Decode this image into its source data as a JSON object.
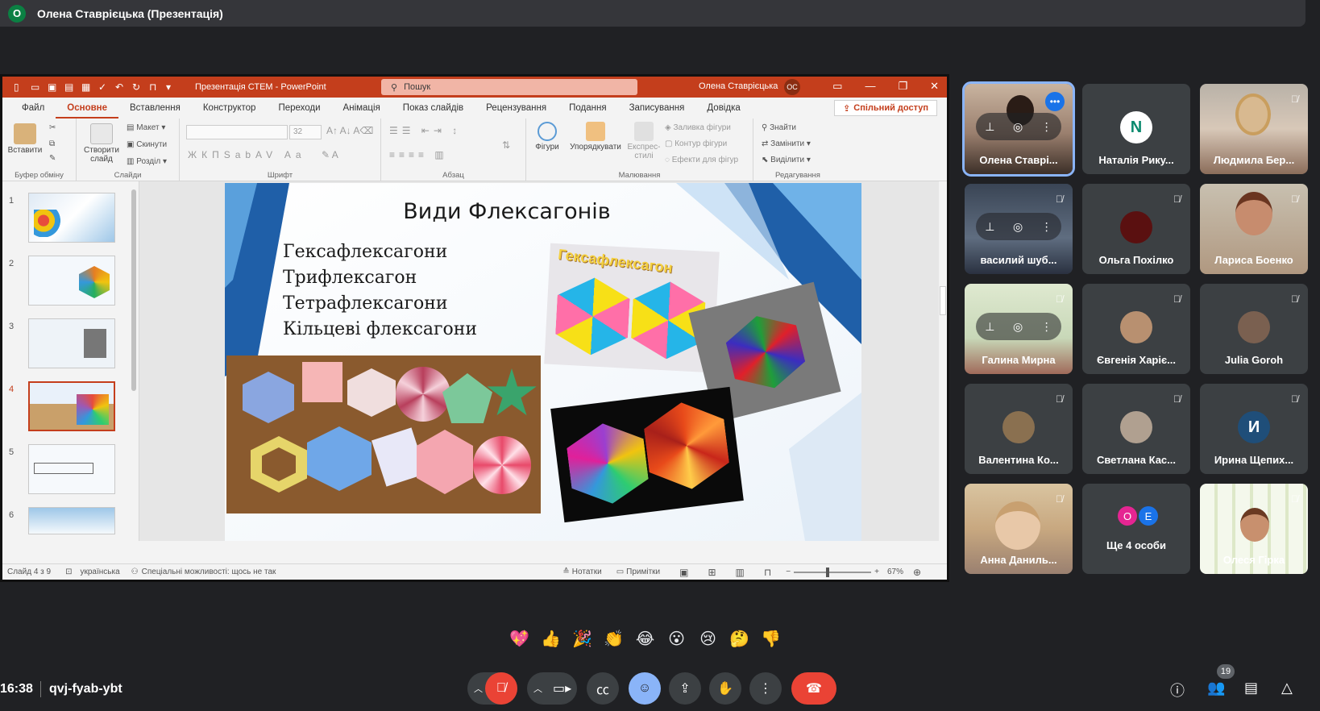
{
  "presenter": {
    "avatar": "О",
    "name": "Олена Ставрієцька (Презентація)"
  },
  "ppt": {
    "doc_title": "Презентація СТЕМ  -  PowerPoint",
    "search_placeholder": "Пошук",
    "user": "Олена Ставрієцька",
    "user_initials": "ОС",
    "tabs": [
      "Файл",
      "Основне",
      "Вставлення",
      "Конструктор",
      "Переходи",
      "Анімація",
      "Показ слайдів",
      "Рецензування",
      "Подання",
      "Записування",
      "Довідка"
    ],
    "share_label": "Спільний доступ",
    "ribbon": {
      "paste": "Вставити",
      "clipboard": "Буфер обміну",
      "new_slide": "Створити слайд",
      "layout": "Макет",
      "reset": "Скинути",
      "section": "Розділ",
      "slides": "Слайди",
      "font_group": "Шрифт",
      "font_size": "32",
      "paragraph": "Абзац",
      "shapes": "Фігури",
      "arrange": "Упорядкувати",
      "quick_styles": "Експрес-стилі",
      "shape_fill": "Заливка фігури",
      "shape_outline": "Контур фігури",
      "shape_effects": "Ефекти для фігур",
      "drawing": "Малювання",
      "find": "Знайти",
      "replace": "Замінити",
      "select": "Виділити",
      "editing": "Редагування"
    },
    "thumbnails": [
      "1",
      "2",
      "3",
      "4",
      "5",
      "6"
    ],
    "slide": {
      "title": "Види Флексагонів",
      "items": [
        "Гексафлексагони",
        "Трифлексагон",
        "Тетрафлексагони",
        "Кільцеві флексагони"
      ],
      "photo_caption": "Гексафлексагон"
    },
    "status": {
      "slide_of": "Слайд 4 з 9",
      "language": "українська",
      "accessibility": "Спеціальні можливості: щось не так",
      "notes": "Нотатки",
      "comments": "Примітки",
      "zoom": "67%"
    }
  },
  "participants": [
    {
      "name": "Олена Ставрі...",
      "type": "video",
      "active": true
    },
    {
      "name": "Наталія Рику...",
      "type": "avatar",
      "initial": "N",
      "color": "#ffffff",
      "fg": "#0b8a6e"
    },
    {
      "name": "Людмила Бер...",
      "type": "video"
    },
    {
      "name": "василий шуб...",
      "type": "video"
    },
    {
      "name": "Ольга Похілко",
      "type": "avatar",
      "initial": "",
      "color": "#5a1010"
    },
    {
      "name": "Лариса Боенко",
      "type": "video"
    },
    {
      "name": "Галина Мирна",
      "type": "video"
    },
    {
      "name": "Євгенія Харіє...",
      "type": "avatar",
      "initial": "",
      "color": "#b89070"
    },
    {
      "name": "Julia Goroh",
      "type": "avatar",
      "initial": "",
      "color": "#7a6050"
    },
    {
      "name": "Валентина Ко...",
      "type": "avatar",
      "initial": "",
      "color": "#8a7050"
    },
    {
      "name": "Светлана Кас...",
      "type": "avatar",
      "initial": "",
      "color": "#b0a090"
    },
    {
      "name": "Ирина Щепих...",
      "type": "avatar",
      "initial": "И",
      "color": "#1f4e79",
      "fg": "#ffffff"
    },
    {
      "name": "Анна Даниль...",
      "type": "video"
    },
    {
      "name": "Ще 4 особи",
      "type": "more",
      "a": "О",
      "b": "Е"
    },
    {
      "name": "Олеся Гірка",
      "type": "video"
    }
  ],
  "reactions": [
    "💖",
    "👍",
    "🎉",
    "👏",
    "😂",
    "😮",
    "😢",
    "🤔",
    "👎"
  ],
  "bottom": {
    "time": "16:38",
    "meeting_code": "qvj-fyab-ybt",
    "people_count": "19"
  }
}
